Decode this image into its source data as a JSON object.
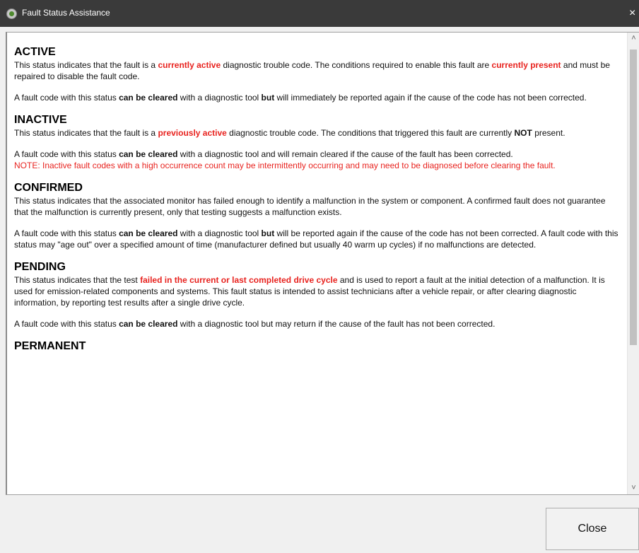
{
  "window": {
    "title": "Fault Status Assistance",
    "close_glyph": "×"
  },
  "sections": [
    {
      "title": "ACTIVE",
      "paragraphs": [
        [
          {
            "t": "This status indicates that the fault is a "
          },
          {
            "t": "currently active",
            "red": true,
            "bold": true
          },
          {
            "t": " diagnostic trouble code. The conditions required to enable this fault are "
          },
          {
            "t": "currently present",
            "red": true,
            "bold": true
          },
          {
            "t": " and must be repaired to disable the fault code."
          }
        ],
        [
          {
            "t": "A fault code with this status "
          },
          {
            "t": "can be cleared",
            "bold": true
          },
          {
            "t": " with a diagnostic tool "
          },
          {
            "t": "but",
            "bold": true
          },
          {
            "t": " will immediately be reported again if the cause of the code has not been corrected."
          }
        ]
      ]
    },
    {
      "title": "INACTIVE",
      "paragraphs": [
        [
          {
            "t": "This status indicates that the fault is a "
          },
          {
            "t": "previously active",
            "red": true,
            "bold": true
          },
          {
            "t": " diagnostic trouble code. The conditions that triggered this fault are currently "
          },
          {
            "t": "NOT",
            "bold": true
          },
          {
            "t": " present."
          }
        ],
        [
          {
            "t": "A fault code with this status "
          },
          {
            "t": "can be cleared",
            "bold": true
          },
          {
            "t": " with a diagnostic tool and will remain cleared if the cause of the fault has been corrected."
          },
          {
            "br": true
          },
          {
            "t": "NOTE: Inactive fault codes with a high occurrence count may be intermittently occurring and may need to be diagnosed before clearing the fault.",
            "red": true
          }
        ]
      ]
    },
    {
      "title": "CONFIRMED",
      "paragraphs": [
        [
          {
            "t": "This status indicates that the associated monitor has failed enough to identify a malfunction in the system or component.  A confirmed fault does not guarantee that the malfunction is currently present, only that testing suggests a malfunction exists."
          }
        ],
        [
          {
            "t": "A fault code with this status "
          },
          {
            "t": "can be cleared",
            "bold": true
          },
          {
            "t": " with a diagnostic tool "
          },
          {
            "t": "but",
            "bold": true
          },
          {
            "t": " will be reported again if the cause of the code has not been corrected.  A fault code with this status may \"age out\" over a specified amount of time (manufacturer defined but usually 40 warm up cycles) if no malfunctions are detected."
          }
        ]
      ]
    },
    {
      "title": "PENDING",
      "paragraphs": [
        [
          {
            "t": "This status indicates that the test "
          },
          {
            "t": "failed in the current or last completed drive cycle",
            "red": true,
            "bold": true
          },
          {
            "t": " and is used to report a fault at the initial detection of a malfunction. It is used for emission-related components and systems. This fault status is intended to assist technicians after a vehicle repair, or after clearing diagnostic information, by reporting test results after a single drive cycle."
          }
        ],
        [
          {
            "t": "A fault code with this status "
          },
          {
            "t": "can be cleared",
            "bold": true
          },
          {
            "t": " with a diagnostic tool but may return if the cause of the fault has not been corrected."
          }
        ]
      ]
    },
    {
      "title": "PERMANENT",
      "paragraphs": []
    }
  ],
  "scrollbar": {
    "up_glyph": "˄",
    "down_glyph": "˅",
    "scroll_fraction": 0.0
  },
  "footer": {
    "close_label": "Close"
  },
  "icons": {
    "app": "app-logo-icon",
    "window_close": "close-icon"
  }
}
